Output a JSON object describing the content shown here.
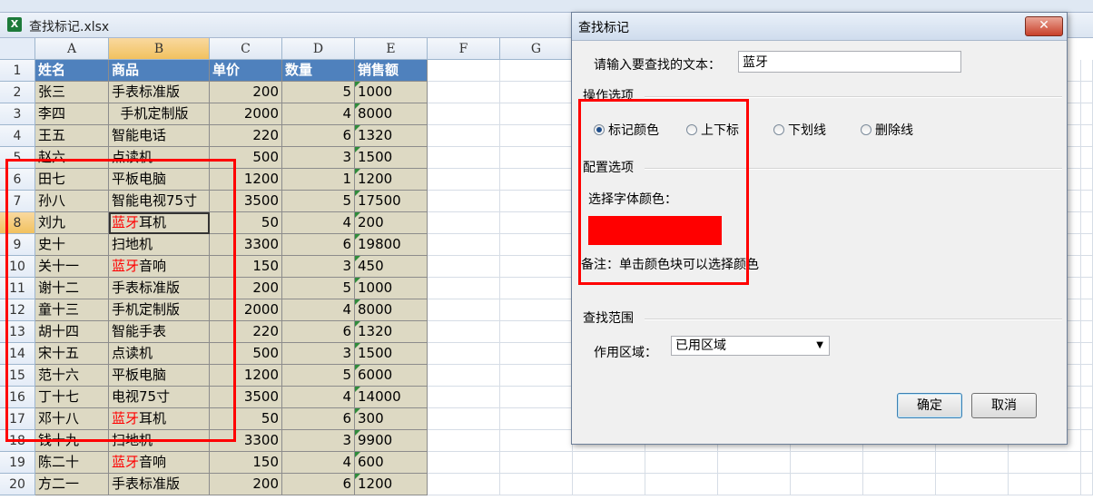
{
  "workbook": {
    "title": "查找标记.xlsx",
    "icon": "excel-icon"
  },
  "columns": [
    "A",
    "B",
    "C",
    "D",
    "E",
    "F",
    "G"
  ],
  "header_row": {
    "row": "1",
    "cells": [
      "姓名",
      "商品",
      "单价",
      "数量",
      "销售额"
    ]
  },
  "rows": [
    {
      "row": "2",
      "name": "张三",
      "product": "手表标准版",
      "price": "200",
      "qty": "5",
      "sales": "1000"
    },
    {
      "row": "3",
      "name": "李四",
      "product": "  手机定制版",
      "price": "2000",
      "qty": "4",
      "sales": "8000"
    },
    {
      "row": "4",
      "name": "王五",
      "product": "智能电话",
      "price": "220",
      "qty": "6",
      "sales": "1320"
    },
    {
      "row": "5",
      "name": "赵六",
      "product": "点读机",
      "price": "500",
      "qty": "3",
      "sales": "1500"
    },
    {
      "row": "6",
      "name": "田七",
      "product": "平板电脑",
      "price": "1200",
      "qty": "1",
      "sales": "1200"
    },
    {
      "row": "7",
      "name": "孙八",
      "product": "智能电视75寸",
      "price": "3500",
      "qty": "5",
      "sales": "17500"
    },
    {
      "row": "8",
      "name": "刘九",
      "product_hl": "蓝牙",
      "product_rest": "耳机",
      "price": "50",
      "qty": "4",
      "sales": "200"
    },
    {
      "row": "9",
      "name": "史十",
      "product": "扫地机",
      "price": "3300",
      "qty": "6",
      "sales": "19800"
    },
    {
      "row": "10",
      "name": "关十一",
      "product_hl": "蓝牙",
      "product_rest": "音响",
      "price": "150",
      "qty": "3",
      "sales": "450"
    },
    {
      "row": "11",
      "name": "谢十二",
      "product": "手表标准版",
      "price": "200",
      "qty": "5",
      "sales": "1000"
    },
    {
      "row": "12",
      "name": "童十三",
      "product": "手机定制版",
      "price": "2000",
      "qty": "4",
      "sales": "8000"
    },
    {
      "row": "13",
      "name": "胡十四",
      "product": "智能手表",
      "price": "220",
      "qty": "6",
      "sales": "1320"
    },
    {
      "row": "14",
      "name": "宋十五",
      "product": "点读机",
      "price": "500",
      "qty": "3",
      "sales": "1500"
    },
    {
      "row": "15",
      "name": "范十六",
      "product": "平板电脑",
      "price": "1200",
      "qty": "5",
      "sales": "6000"
    },
    {
      "row": "16",
      "name": "丁十七",
      "product": "电视75寸",
      "price": "3500",
      "qty": "4",
      "sales": "14000"
    },
    {
      "row": "17",
      "name": "邓十八",
      "product_hl": "蓝牙",
      "product_rest": "耳机",
      "price": "50",
      "qty": "6",
      "sales": "300"
    },
    {
      "row": "18",
      "name": "钱十九",
      "product": "扫地机",
      "price": "3300",
      "qty": "3",
      "sales": "9900"
    },
    {
      "row": "19",
      "name": "陈二十",
      "product_hl": "蓝牙",
      "product_rest": "音响",
      "price": "150",
      "qty": "4",
      "sales": "600"
    },
    {
      "row": "20",
      "name": "方二一",
      "product": "手表标准版",
      "price": "200",
      "qty": "6",
      "sales": "1200"
    }
  ],
  "colors": {
    "highlight_text": "#ff0000",
    "header_fill": "#4f81bd",
    "cell_fill": "#ddd9c3",
    "annotation_box": "#ff0000"
  },
  "dialog": {
    "title": "查找标记",
    "close_label": "✕",
    "search_label": "请输入要查找的文本：",
    "search_value": "蓝牙",
    "ops_section": "操作选项",
    "options": [
      {
        "label": "标记颜色",
        "selected": true
      },
      {
        "label": "上下标",
        "selected": false
      },
      {
        "label": "下划线",
        "selected": false
      },
      {
        "label": "删除线",
        "selected": false
      }
    ],
    "config_section": "配置选项",
    "font_color_label": "选择字体颜色：",
    "swatch_color": "#ff0000",
    "note": "备注：单击颜色块可以选择颜色",
    "range_section": "查找范围",
    "range_label": "作用区域：",
    "range_value": "已用区域",
    "ok_label": "确定",
    "cancel_label": "取消"
  }
}
